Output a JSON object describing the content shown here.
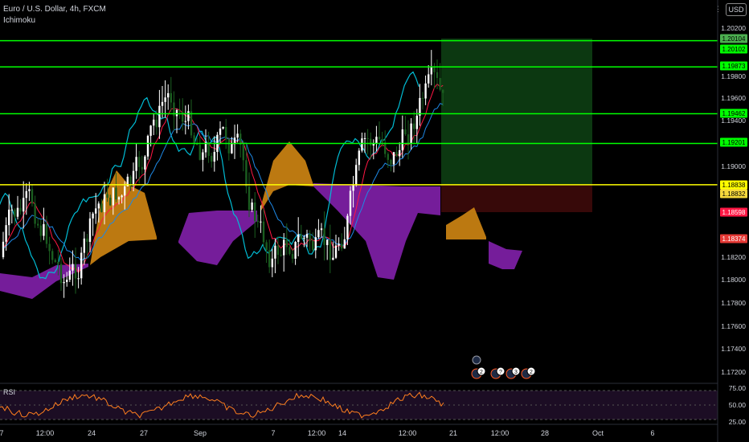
{
  "header": {
    "symbol": "Euro / U.S. Dollar, 4h, FXCM",
    "indicator": "Ichimoku",
    "currency": "USD"
  },
  "rsi": {
    "label": "RSI",
    "levels": [
      "75.00",
      "50.00",
      "25.00"
    ]
  },
  "x_axis": {
    "labels": [
      "7",
      "12:00",
      "24",
      "27",
      "Sep",
      "7",
      "12:00",
      "14",
      "12:00",
      "21",
      "12:00",
      "28",
      "Oct",
      "6"
    ]
  },
  "price_axis": {
    "ticks": [
      "1.20200",
      "1.19800",
      "1.19600",
      "1.19400",
      "1.19000",
      "1.18200",
      "1.18000",
      "1.17800",
      "1.17600",
      "1.17400",
      "1.17200"
    ],
    "markers": [
      {
        "label": "1.20104",
        "bg": "#4caf50",
        "fg": "#000000"
      },
      {
        "label": "1.20102",
        "bg": "#00ff00",
        "fg": "#000000"
      },
      {
        "label": "1.19873",
        "bg": "#00ff00",
        "fg": "#000000"
      },
      {
        "label": "1.19462",
        "bg": "#00ff00",
        "fg": "#000000"
      },
      {
        "label": "1.19201",
        "bg": "#00ff00",
        "fg": "#000000"
      },
      {
        "label": "1.18838",
        "bg": "#ffff00",
        "fg": "#000000"
      },
      {
        "label": "1.18832",
        "bg": "#f5d73b",
        "fg": "#000000"
      },
      {
        "label": "1.18598",
        "bg": "#ff1744",
        "fg": "#ffffff"
      },
      {
        "label": "1.18374",
        "bg": "#e53935",
        "fg": "#ffffff"
      }
    ]
  },
  "events": [
    "2",
    "?",
    "3",
    "2"
  ],
  "colors": {
    "background": "#000000",
    "hline_green": "#00ff00",
    "hline_yellow": "#ffff00",
    "candle_up": "#ffffff",
    "candle_down": "#1b5e20",
    "tenkan": "#00bcd4",
    "kijun": "#ff1744",
    "lagging": "#1e88e5",
    "cloud_bull": "#c67f12",
    "cloud_bear": "#7b1fa2",
    "target_zone": "#0d3b12",
    "stop_zone": "#3a0a0a",
    "rsi_line": "#ff7f1e",
    "rsi_band": "#1c0d24"
  },
  "chart_data": {
    "type": "candlestick",
    "indicators": [
      "Ichimoku",
      "RSI"
    ],
    "horizontal_lines": [
      1.20104,
      1.19873,
      1.19462,
      1.19201,
      1.18838
    ],
    "target_zone": {
      "from": 1.18838,
      "to": 1.20104
    },
    "stop_zone": {
      "from": 1.18598,
      "to": 1.18838
    },
    "last_close": 1.18374,
    "ylim": [
      1.171,
      1.2032
    ]
  }
}
